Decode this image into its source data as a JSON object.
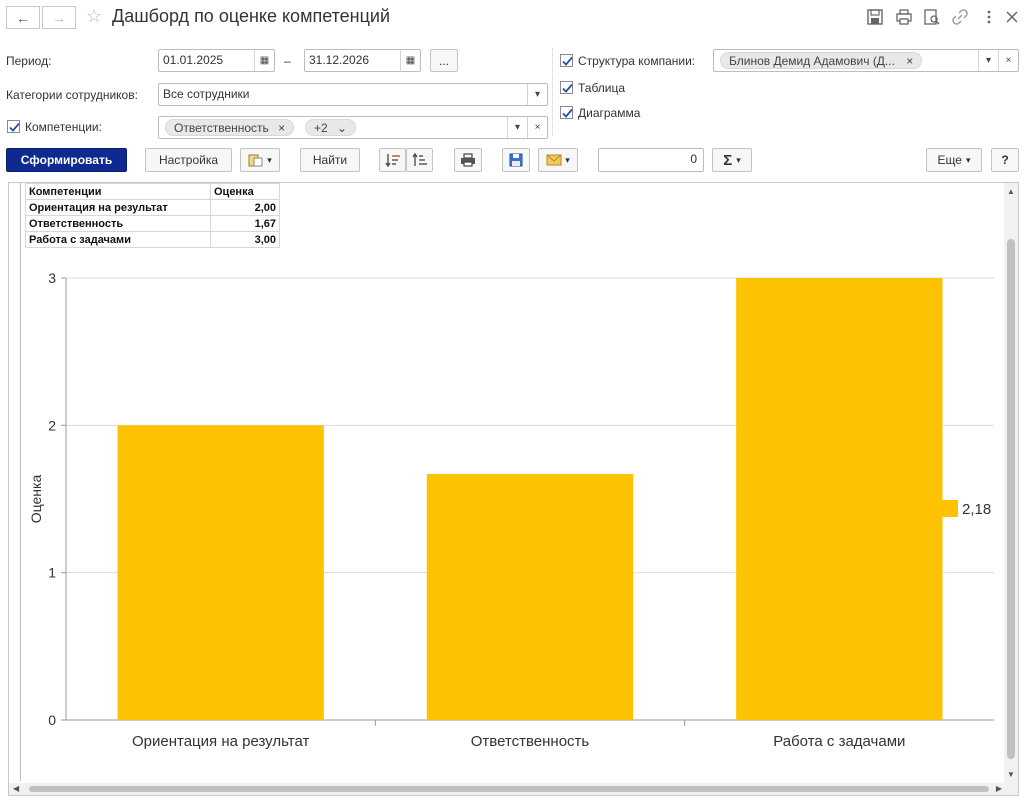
{
  "window": {
    "title": "Дашборд по оценке компетенций",
    "nav_back_icon": "arrow-left-icon",
    "nav_forward_icon": "arrow-right-icon"
  },
  "form": {
    "period_label": "Период:",
    "period_from": "01.01.2025",
    "period_dash": "–",
    "period_to": "31.12.2026",
    "period_more": "...",
    "categories_label": "Категории сотрудников:",
    "categories_value": "Все сотрудники",
    "competencies_label": "Компетенции:",
    "competencies_checked": true,
    "competencies_tag": "Ответственность",
    "competencies_more": "+2",
    "structure_label": "Структура компании:",
    "structure_checked": true,
    "structure_tag": "Блинов Демид Адамович (Д...",
    "table_label": "Таблица",
    "table_checked": true,
    "diagram_label": "Диаграмма",
    "diagram_checked": true
  },
  "toolbar": {
    "generate": "Сформировать",
    "settings": "Настройка",
    "find": "Найти",
    "sum_value": "0",
    "more": "Еще",
    "help": "?"
  },
  "table": {
    "headers": [
      "Компетенции",
      "Оценка"
    ],
    "rows": [
      [
        "Ориентация на результат",
        "2,00"
      ],
      [
        "Ответственность",
        "1,67"
      ],
      [
        "Работа с задачами",
        "3,00"
      ]
    ]
  },
  "chart_data": {
    "type": "bar",
    "categories": [
      "Ориентация на результат",
      "Ответственность",
      "Работа с задачами"
    ],
    "values": [
      2.0,
      1.67,
      3.0
    ],
    "ylabel": "Оценка",
    "xlabel": "",
    "ylim": [
      0,
      3
    ],
    "yticks": [
      "0",
      "1",
      "2",
      "3"
    ],
    "legend": [
      "2,18"
    ],
    "legend_position": "right",
    "bar_color": "#fdc200",
    "grid": true
  }
}
